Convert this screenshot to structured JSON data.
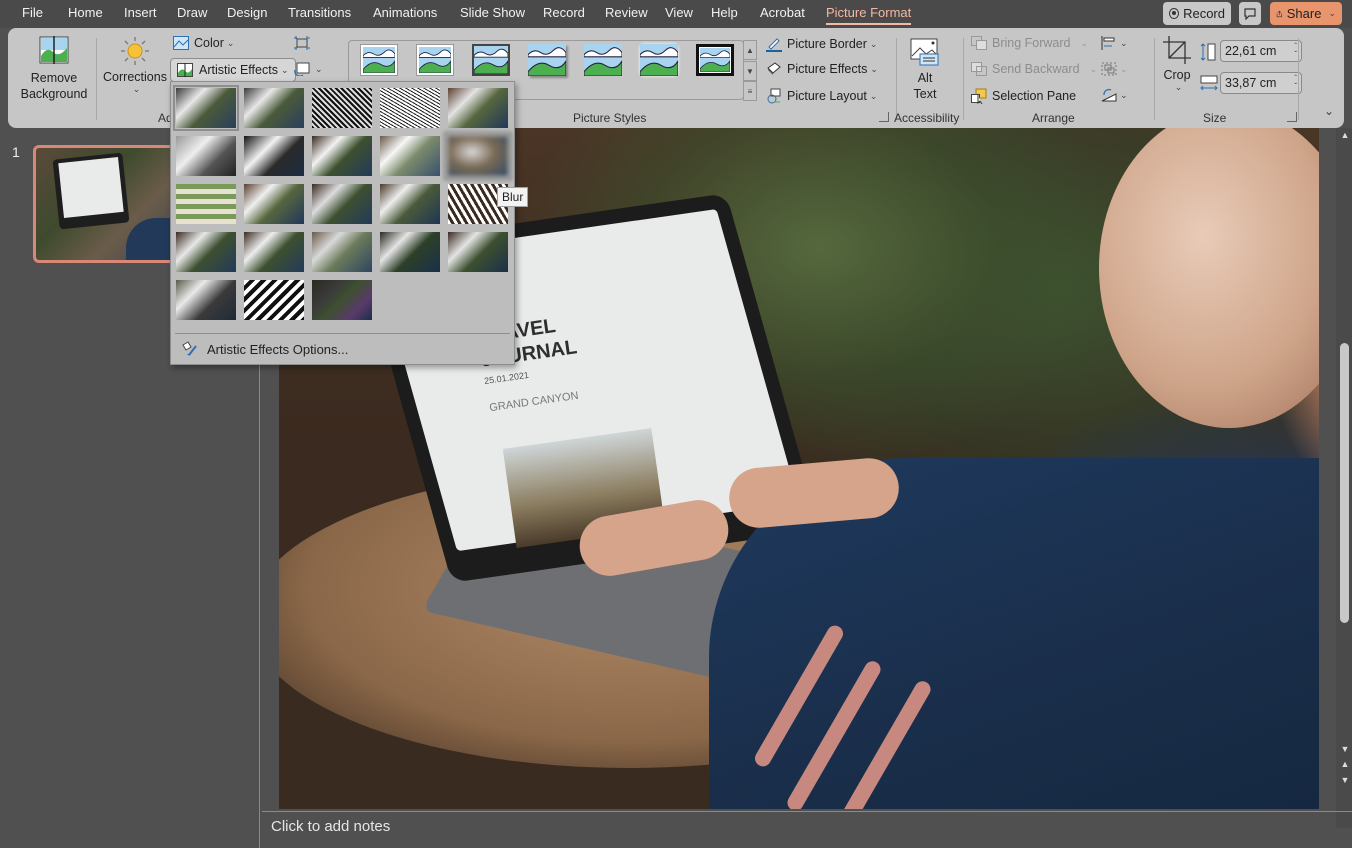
{
  "tabs": [
    {
      "label": "File",
      "active": false
    },
    {
      "label": "Home",
      "active": false
    },
    {
      "label": "Insert",
      "active": false
    },
    {
      "label": "Draw",
      "active": false
    },
    {
      "label": "Design",
      "active": false
    },
    {
      "label": "Transitions",
      "active": false
    },
    {
      "label": "Animations",
      "active": false
    },
    {
      "label": "Slide Show",
      "active": false
    },
    {
      "label": "Record",
      "active": false
    },
    {
      "label": "Review",
      "active": false
    },
    {
      "label": "View",
      "active": false
    },
    {
      "label": "Help",
      "active": false
    },
    {
      "label": "Acrobat",
      "active": false
    },
    {
      "label": "Picture Format",
      "active": true
    }
  ],
  "titlebar": {
    "record_label": "Record",
    "share_label": "Share"
  },
  "ribbon": {
    "adjust": {
      "remove_bg_line1": "Remove",
      "remove_bg_line2": "Background",
      "corrections_label": "Corrections",
      "color_label": "Color",
      "artistic_effects_label": "Artistic Effects",
      "group_label": "Adjust"
    },
    "picture_styles": {
      "group_label": "Picture Styles",
      "picture_border_label": "Picture Border",
      "picture_effects_label": "Picture Effects",
      "picture_layout_label": "Picture Layout",
      "style_count": 7
    },
    "accessibility": {
      "alt_text_line1": "Alt",
      "alt_text_line2": "Text",
      "group_label": "Accessibility"
    },
    "arrange": {
      "bring_forward_label": "Bring Forward",
      "send_backward_label": "Send Backward",
      "selection_pane_label": "Selection Pane",
      "group_label": "Arrange"
    },
    "size": {
      "crop_label": "Crop",
      "height_value": "22,61 cm",
      "width_value": "33,87 cm",
      "group_label": "Size"
    }
  },
  "artistic_effects_menu": {
    "effects": [
      {
        "name": "None",
        "state": "selected"
      },
      {
        "name": "Marker",
        "state": ""
      },
      {
        "name": "Pencil Grayscale",
        "state": ""
      },
      {
        "name": "Pencil Sketch",
        "state": ""
      },
      {
        "name": "Line Drawing",
        "state": ""
      },
      {
        "name": "Chalk Sketch",
        "state": ""
      },
      {
        "name": "Paint Strokes",
        "state": ""
      },
      {
        "name": "Paint Brush",
        "state": ""
      },
      {
        "name": "Glow Diffused",
        "state": ""
      },
      {
        "name": "Blur",
        "state": "hover"
      },
      {
        "name": "Mosaic Bubbles",
        "state": ""
      },
      {
        "name": "Glass",
        "state": ""
      },
      {
        "name": "Cement",
        "state": ""
      },
      {
        "name": "Texturizer",
        "state": ""
      },
      {
        "name": "Crisscross Etching",
        "state": ""
      },
      {
        "name": "Pastels Smooth",
        "state": ""
      },
      {
        "name": "Plastic Wrap",
        "state": ""
      },
      {
        "name": "Cutout",
        "state": ""
      },
      {
        "name": "Photocopy",
        "state": ""
      },
      {
        "name": "Film Grain",
        "state": ""
      },
      {
        "name": "Watercolor Sponge",
        "state": ""
      },
      {
        "name": "Light Screen",
        "state": ""
      },
      {
        "name": "Glow Edges",
        "state": ""
      }
    ],
    "options_label": "Artistic Effects Options...",
    "tooltip": "Blur"
  },
  "slides_pane": {
    "slide_number": "1"
  },
  "slide": {
    "doc_title": "TRAVEL\nJOURNAL",
    "doc_date": "25.01.2021",
    "doc_subtitle": "GRAND CANYON"
  },
  "notes": {
    "placeholder": "Click to add notes"
  }
}
